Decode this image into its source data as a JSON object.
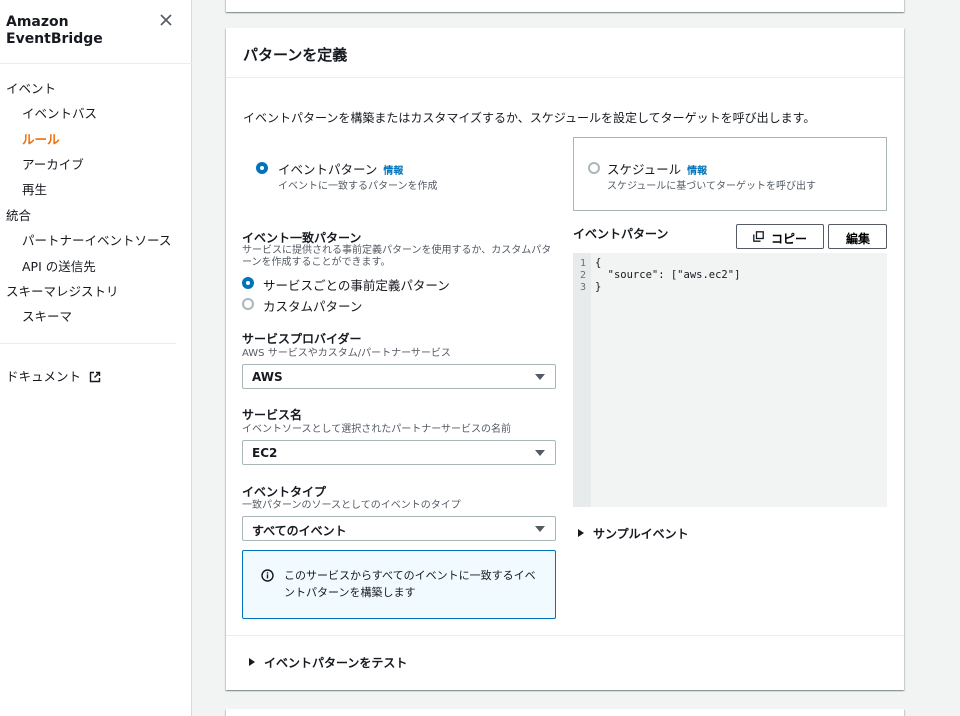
{
  "sidebar": {
    "title_line1": "Amazon",
    "title_line2": "EventBridge",
    "sections": [
      {
        "label": "イベント"
      },
      {
        "label": "統合"
      },
      {
        "label": "スキーマレジストリ"
      }
    ],
    "items": [
      {
        "label": "イベントバス"
      },
      {
        "label": "ルール"
      },
      {
        "label": "アーカイブ"
      },
      {
        "label": "再生"
      },
      {
        "label": "パートナーイベントソース"
      },
      {
        "label": "API の送信先"
      },
      {
        "label": "スキーマ"
      }
    ],
    "docs_label": "ドキュメント"
  },
  "main": {
    "title": "パターンを定義",
    "description": "イベントパターンを構築またはカスタマイズするか、スケジュールを設定してターゲットを呼び出します。",
    "tile_event": {
      "label": "イベントパターン",
      "info": "情報",
      "sub": "イベントに一致するパターンを作成"
    },
    "tile_schedule": {
      "label": "スケジュール",
      "info": "情報",
      "sub": "スケジュールに基づいてターゲットを呼び出す"
    },
    "match": {
      "label": "イベント一致パターン",
      "hint": "サービスに提供される事前定義パターンを使用するか、カスタムパターンを作成することができます。",
      "opt_predefined": "サービスごとの事前定義パターン",
      "opt_custom": "カスタムパターン"
    },
    "provider": {
      "label": "サービスプロバイダー",
      "hint": "AWS サービスやカスタム/パートナーサービス",
      "value": "AWS"
    },
    "service": {
      "label": "サービス名",
      "hint": "イベントソースとして選択されたパートナーサービスの名前",
      "value": "EC2"
    },
    "event_type": {
      "label": "イベントタイプ",
      "hint": "一致パターンのソースとしてのイベントのタイプ",
      "value": "すべてのイベント"
    },
    "alert_text": "このサービスからすべてのイベントに一致するイベントパターンを構築します",
    "pattern": {
      "label": "イベントパターン",
      "copy": "コピー",
      "edit": "編集",
      "lines": [
        "{",
        "  \"source\": [\"aws.ec2\"]",
        "}"
      ],
      "line_numbers": [
        "1",
        "2",
        "3"
      ]
    },
    "sample_events": "サンプルイベント",
    "test_pattern": "イベントパターンをテスト"
  },
  "colors": {
    "accent": "#ec7211",
    "link": "#0073bb"
  }
}
